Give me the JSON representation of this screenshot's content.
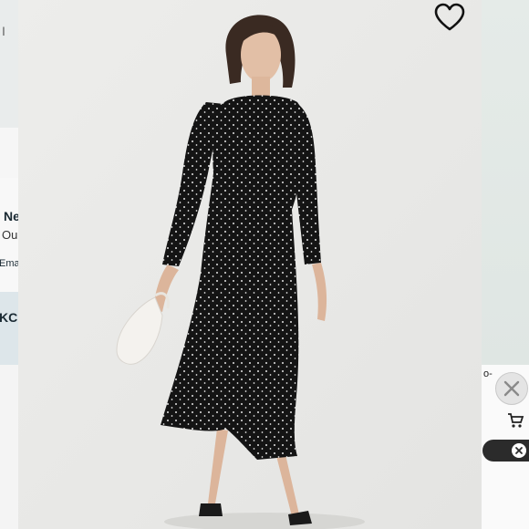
{
  "left_panel": {
    "top_text": "I",
    "headline": "Ne",
    "subline": "Ou",
    "email_label": "Ema",
    "button_text": "KC"
  },
  "right_panel": {
    "label": "o-"
  },
  "icons": {
    "favorite": "heart-icon",
    "close": "close-icon",
    "cart": "cart-icon",
    "clear": "clear-icon"
  },
  "colors": {
    "dress": "#141414",
    "dot": "#f2f2f2",
    "background": "#e9e9e7",
    "accent_dark": "#2b2b2b"
  }
}
